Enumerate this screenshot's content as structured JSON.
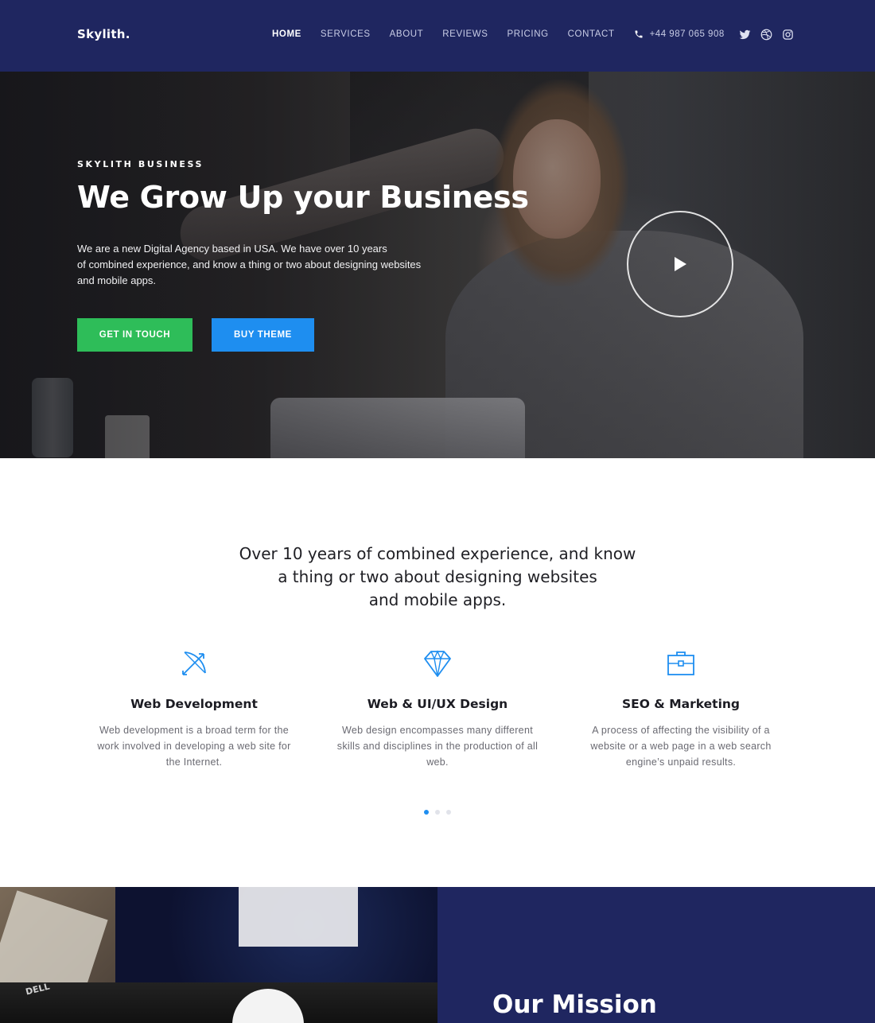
{
  "brand": "Skylith.",
  "nav": {
    "items": [
      {
        "label": "HOME",
        "active": true
      },
      {
        "label": "SERVICES"
      },
      {
        "label": "ABOUT"
      },
      {
        "label": "REVIEWS"
      },
      {
        "label": "PRICING"
      },
      {
        "label": "CONTACT"
      }
    ],
    "phone": "+44 987 065 908",
    "socials": [
      "twitter-icon",
      "dribbble-icon",
      "instagram-icon"
    ]
  },
  "hero": {
    "eyebrow": "SKYLITH BUSINESS",
    "title": "We Grow Up your Business",
    "text": "We are a new Digital Agency based in USA. We have over 10 years\nof combined experience, and know a thing or two about designing websites\nand mobile apps.",
    "primary_button": "GET IN TOUCH",
    "secondary_button": "BUY THEME"
  },
  "intro": "Over 10 years of combined experience, and know\na thing or two about designing websites\nand mobile apps.",
  "services": [
    {
      "icon": "bow-arrow-icon",
      "title": "Web Development",
      "text": "Web development is a broad term for the\nwork involved in developing a web site for\nthe Internet."
    },
    {
      "icon": "diamond-icon",
      "title": "Web & UI/UX Design",
      "text": "Web design encompasses many different\nskills and disciplines in the production of all\nweb."
    },
    {
      "icon": "briefcase-icon",
      "title": "SEO & Marketing",
      "text": "A process of affecting the visibility of a\nwebsite or a web page in a web search\nengine’s unpaid results."
    }
  ],
  "carousel": {
    "pages": 3,
    "active": 1
  },
  "mission": {
    "title": "Our Mission",
    "photo_brand": "DELL"
  },
  "colors": {
    "navy": "#1f2660",
    "green": "#2ebd59",
    "blue": "#1e8ef0"
  }
}
